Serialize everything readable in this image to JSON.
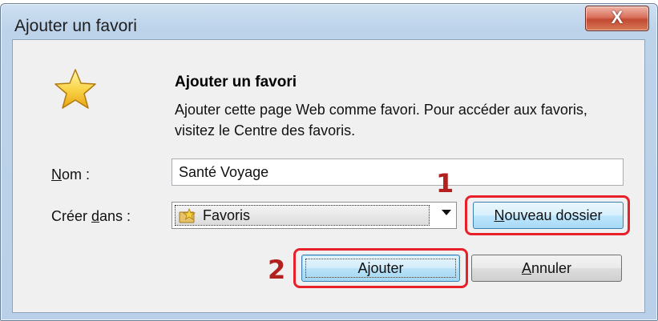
{
  "window": {
    "title": "Ajouter un favori",
    "close_glyph": "X"
  },
  "dialog": {
    "heading": "Ajouter un favori",
    "description": "Ajouter cette page Web comme favori. Pour accéder aux favoris, visitez le Centre des favoris.",
    "name_label_prefix": "N",
    "name_label_rest": "om :",
    "name_value": "Santé Voyage",
    "create_label_prefix": "Créer ",
    "create_label_underlined": "d",
    "create_label_rest": "ans :",
    "folder_selected": "Favoris",
    "new_folder_button_underlined": "N",
    "new_folder_button_rest": "ouveau dossier",
    "add_button_prefix": "A",
    "add_button_underlined": "j",
    "add_button_rest": "outer",
    "cancel_button_underlined": "A",
    "cancel_button_rest": "nnuler"
  },
  "annotations": {
    "step1": "1",
    "step2": "2",
    "color": "#e8202a"
  },
  "icons": {
    "favorite": "star-icon",
    "close": "close-icon",
    "dropdown": "chevron-down-icon"
  }
}
